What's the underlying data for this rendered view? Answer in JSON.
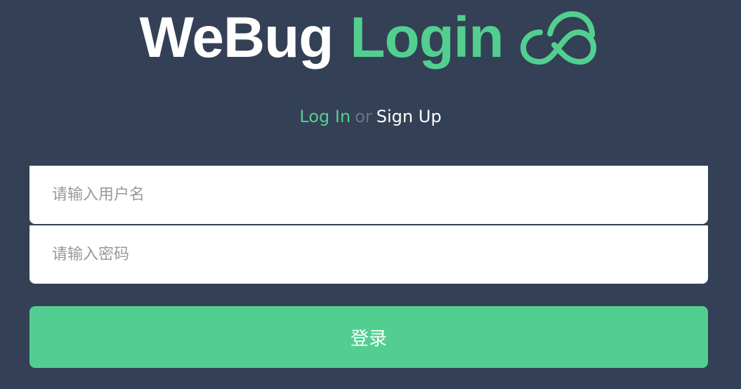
{
  "header": {
    "title_part1": "WeBug",
    "title_part2": "Login",
    "logo_icon": "cloud-icon"
  },
  "auth_switch": {
    "login": "Log In",
    "separator": "or",
    "signup": "Sign Up"
  },
  "form": {
    "username_placeholder": "请输入用户名",
    "password_placeholder": "请输入密码",
    "submit_label": "登录"
  },
  "colors": {
    "background": "#344055",
    "accent": "#52cf90",
    "text_light": "#ffffff",
    "muted": "#6b7383"
  }
}
